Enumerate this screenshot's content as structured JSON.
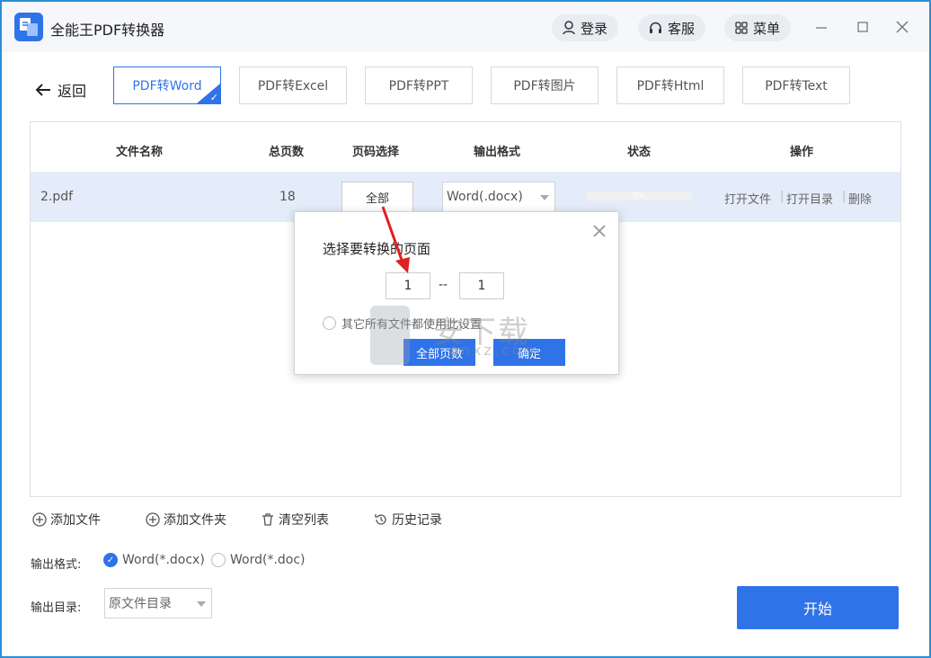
{
  "app": {
    "title": "全能王PDF转换器"
  },
  "header": {
    "login_label": "登录",
    "service_label": "客服",
    "menu_label": "菜单"
  },
  "nav": {
    "back_label": "返回",
    "tabs": [
      {
        "label": "PDF转Word",
        "active": true
      },
      {
        "label": "PDF转Excel",
        "active": false
      },
      {
        "label": "PDF转PPT",
        "active": false
      },
      {
        "label": "PDF转图片",
        "active": false
      },
      {
        "label": "PDF转Html",
        "active": false
      },
      {
        "label": "PDF转Text",
        "active": false
      }
    ]
  },
  "table": {
    "headers": [
      "文件名称",
      "总页数",
      "页码选择",
      "输出格式",
      "状态",
      "操作"
    ],
    "rows": [
      {
        "name": "2.pdf",
        "pages": "18",
        "range": "全部",
        "format": "Word(.docx)",
        "progress_text": "0%",
        "progress": 0,
        "ops": [
          "打开文件",
          "打开目录",
          "删除"
        ]
      }
    ]
  },
  "toolbar": {
    "add_file": "添加文件",
    "add_folder": "添加文件夹",
    "clear_list": "清空列表",
    "history": "历史记录"
  },
  "settings": {
    "output_format_label": "输出格式:",
    "format_options": [
      {
        "label": "Word(*.docx)",
        "selected": true
      },
      {
        "label": "Word(*.doc)",
        "selected": false
      }
    ],
    "output_dir_label": "输出目录:",
    "output_dir_value": "原文件目录",
    "start_label": "开始"
  },
  "dialog": {
    "title": "选择要转换的页面",
    "from": "1",
    "separator": "--",
    "to": "1",
    "apply_all_label": "其它所有文件都使用此设置",
    "all_pages_label": "全部页数",
    "confirm_label": "确定"
  },
  "watermark": {
    "text": "安下载",
    "sub": "anxz.com"
  },
  "colors": {
    "accent": "#2f73e8",
    "row_highlight": "#e4ecfa",
    "annotation_arrow": "#e02020"
  }
}
